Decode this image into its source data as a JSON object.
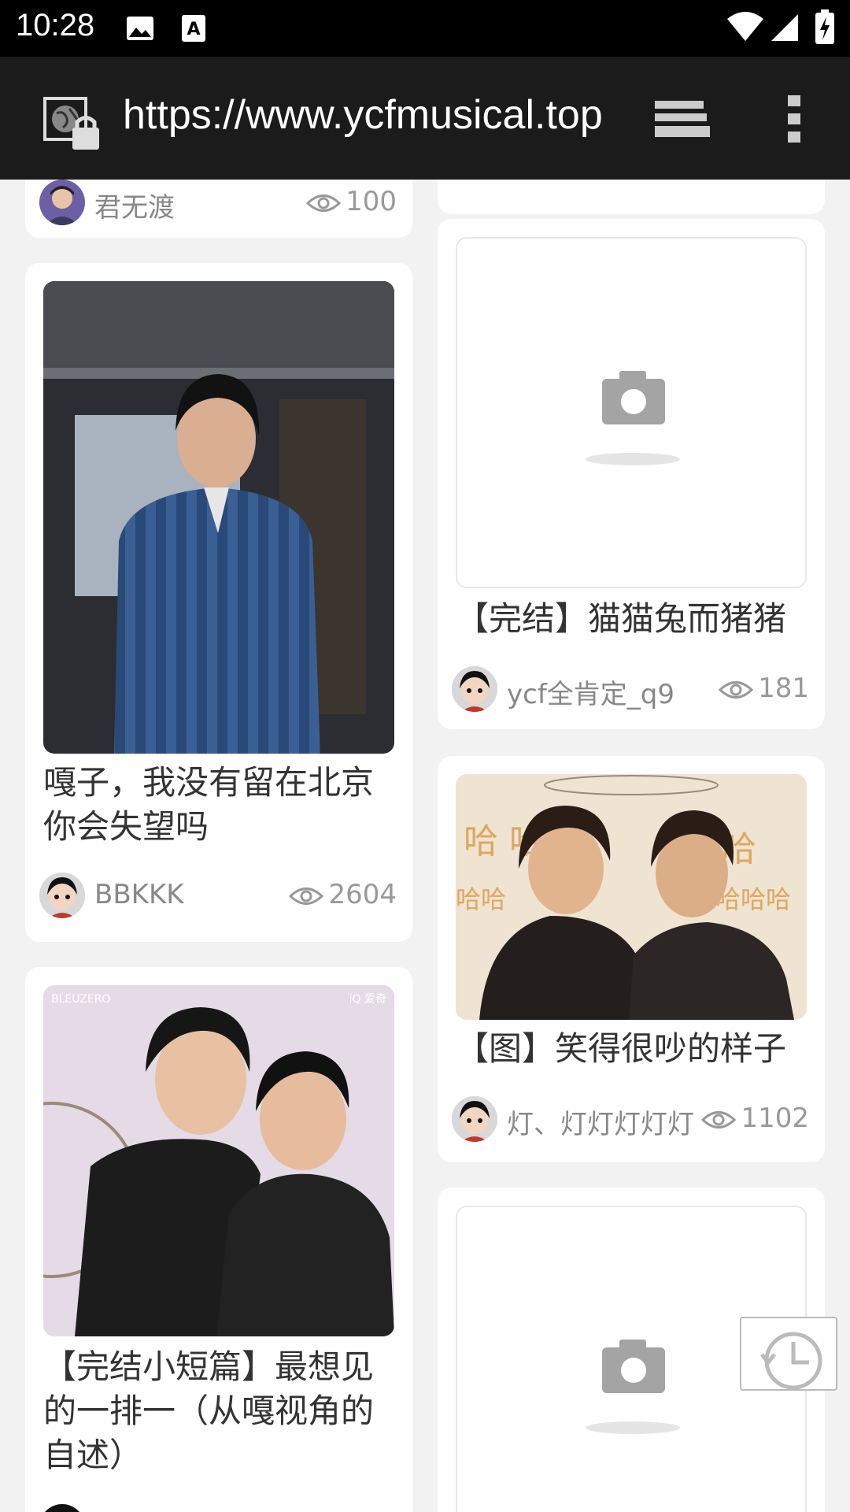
{
  "status_bar": {
    "time": "10:28"
  },
  "browser": {
    "url": "https://www.ycfmusical.top"
  },
  "cards": [
    {
      "author": "君无渡",
      "views": "100"
    },
    {
      "title": "嘎子，我没有留在北京你会失望吗",
      "author": "BBKKK",
      "views": "2604"
    },
    {
      "title": "【完结小短篇】最想见的一排一（从嘎视角的自述）"
    },
    {
      "title": "【完结】猫猫兔而猪猪",
      "author": "ycf全肯定_q9",
      "views": "181"
    },
    {
      "title": "【图】笑得很吵的样子",
      "author": "灯、灯灯灯灯灯",
      "views": "1102"
    }
  ],
  "image_watermarks": {
    "left": "BLEUZERO",
    "right": "iQ 爱奇"
  },
  "colors": {
    "status_bar": "#000000",
    "toolbar": "#1b1b1b",
    "page_bg": "#f2f2f2",
    "card_bg": "#ffffff"
  }
}
